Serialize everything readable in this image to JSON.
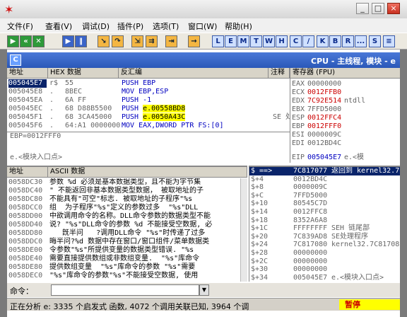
{
  "window": {
    "min": "_",
    "max": "□",
    "close": "×",
    "sysmenu_icon": "bug-icon"
  },
  "menu": [
    "文件(F)",
    "查看(V)",
    "调试(D)",
    "插件(P)",
    "选项(T)",
    "窗口(W)",
    "帮助(H)"
  ],
  "toolbar": {
    "letters": [
      "L",
      "E",
      "M",
      "T",
      "W",
      "H",
      "C",
      "/",
      "K",
      "B",
      "R",
      "...",
      "S"
    ]
  },
  "mdi": {
    "icon": "C",
    "title": "CPU - 主线程, 模块 - e"
  },
  "disasm": {
    "headers": {
      "addr": "地址",
      "hex": "HEX 数据",
      "dis": "反汇编",
      "comment": "注释"
    },
    "rows": [
      {
        "addr": "005045E7",
        "mark": "r$",
        "hex": "55",
        "dis": "PUSH EBP",
        "hl": "",
        "comment": ""
      },
      {
        "addr": "005045E8",
        "mark": ".",
        "hex": "8BEC",
        "dis": "MOV EBP,ESP",
        "hl": "",
        "comment": ""
      },
      {
        "addr": "005045EA",
        "mark": ".",
        "hex": "6A FF",
        "dis": "PUSH -1",
        "hl": "",
        "comment": ""
      },
      {
        "addr": "005045EC",
        "mark": ".",
        "hex": "68 D88B5500",
        "dis": "PUSH ",
        "hl": "e.00558BD8",
        "comment": ""
      },
      {
        "addr": "005045F1",
        "mark": ".",
        "hex": "68 3CA45000",
        "dis": "PUSH ",
        "hl": "e.0050A43C",
        "comment": "SE 处"
      },
      {
        "addr": "005045F6",
        "mark": ".",
        "hex": "64:A1 0000000",
        "dis": "MOV EAX,DWORD PTR FS:[0]",
        "hl": "",
        "comment": ""
      }
    ],
    "info1": "EBP=0012FFF0",
    "info2": "e.<模块入口点>"
  },
  "registers": {
    "header": "寄存器 (FPU)",
    "rows": [
      {
        "name": "EAX",
        "val": "00000000",
        "extra": "",
        "red": false
      },
      {
        "name": "ECX",
        "val": "0012FFB0",
        "extra": "",
        "red": true
      },
      {
        "name": "EDX",
        "val": "7C92E514",
        "extra": "ntdll",
        "red": true
      },
      {
        "name": "EBX",
        "val": "7FFD5000",
        "extra": "",
        "red": false
      },
      {
        "name": "ESP",
        "val": "0012FFC4",
        "extra": "",
        "red": true
      },
      {
        "name": "EBP",
        "val": "0012FFF0",
        "extra": "",
        "red": true
      },
      {
        "name": "ESI",
        "val": "0000009C",
        "extra": "",
        "red": false
      },
      {
        "name": "EDI",
        "val": "0012BD4C",
        "extra": "",
        "red": false
      }
    ],
    "eip_name": "EIP",
    "eip_val": "005045E7",
    "eip_extra": "e.<模"
  },
  "dump": {
    "headers": {
      "addr": "地址",
      "ascii": "ASCII 数据"
    },
    "rows": [
      {
        "addr": "0058DC30",
        "txt": "参数 %d 必须是基本数据类型，且不能为字节集"
      },
      {
        "addr": "0058DC40",
        "txt": "\" 不能返回非基本数据类型数据， 被取地址的子"
      },
      {
        "addr": "0058DC80",
        "txt": "不能具有\"可空\"标志. 被取地址的子程序\"%s"
      },
      {
        "addr": "0058DCC0",
        "txt": "组  为子程序\"%s\"定义的参数过多  \"%s\"DLL"
      },
      {
        "addr": "0058DD00",
        "txt": "中欲调用命令的名称。DLL命令参数的数据类型不能"
      },
      {
        "addr": "0058DD40",
        "txt": "说? \"%s\"DLL命令的参数 %d 不能接受空数据, 必"
      },
      {
        "addr": "0058DD80",
        "txt": "   旣半问   ?调用DLL命令 \"%s\"时传递了过多"
      },
      {
        "addr": "0058DDC0",
        "txt": "晦半问?%d 数据中存在窗口/窗口组件/菜单数据类"
      },
      {
        "addr": "0058DE00",
        "txt": "令参数\"%s\"所提供变量的数据类型错误. \"%s"
      },
      {
        "addr": "0058DE40",
        "txt": "需要直接提供数组或非数组变量.  \"%s\"库命令"
      },
      {
        "addr": "0058DE80",
        "txt": "提供数组变量  \"%s\"库命令的参数 \"%s\"需要"
      },
      {
        "addr": "0058DEC0",
        "txt": "\"%s\"库命令的参数\"%s\"不能接受空数据, 使用"
      }
    ]
  },
  "stack": {
    "rows": [
      {
        "a": "$ ==>",
        "v": "7C817077",
        "c": "返回到 kernel32.7C",
        "sel": true
      },
      {
        "a": "$+4",
        "v": "0012BD4C",
        "c": "",
        "sel": false
      },
      {
        "a": "$+8",
        "v": "0000009C",
        "c": "",
        "sel": false
      },
      {
        "a": "$+C",
        "v": "7FFD5000",
        "c": "",
        "sel": false
      },
      {
        "a": "$+10",
        "v": "80545C7D",
        "c": "",
        "sel": false
      },
      {
        "a": "$+14",
        "v": "0012FFC8",
        "c": "",
        "sel": false
      },
      {
        "a": "$+18",
        "v": "8352A6A8",
        "c": "",
        "sel": false
      },
      {
        "a": "$+1C",
        "v": "FFFFFFFF",
        "c": "SEH 链尾部",
        "sel": false
      },
      {
        "a": "$+20",
        "v": "7C839AD8",
        "c": "SE处理程序",
        "sel": false
      },
      {
        "a": "$+24",
        "v": "7C817080",
        "c": "kernel32.7C817080",
        "sel": false
      },
      {
        "a": "$+28",
        "v": "00000000",
        "c": "",
        "sel": false
      },
      {
        "a": "$+2C",
        "v": "00000000",
        "c": "",
        "sel": false
      },
      {
        "a": "$+30",
        "v": "00000000",
        "c": "",
        "sel": false
      },
      {
        "a": "$+34",
        "v": "005045E7",
        "c": "e.<模块入口点>",
        "sel": false
      }
    ]
  },
  "command": {
    "label": "命令："
  },
  "status": {
    "text": "正在分析 e: 3335 个启发式 函数, 4072 个调用关联已知, 3964 个调",
    "state": "暂停"
  }
}
